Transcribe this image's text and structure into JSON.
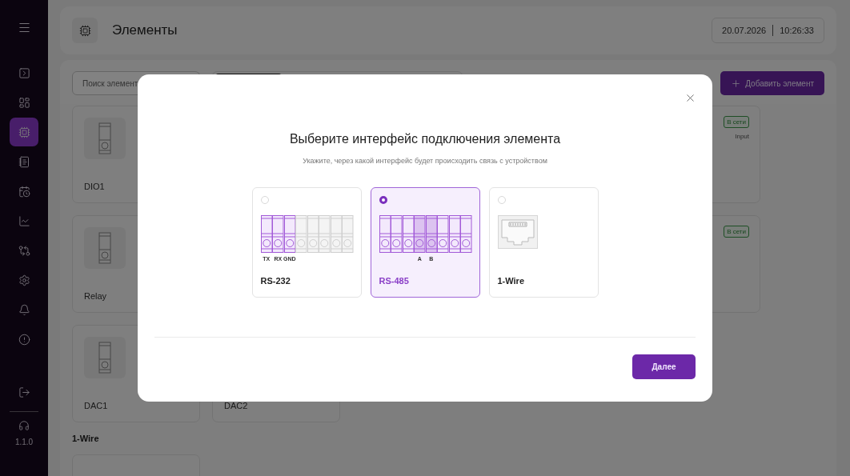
{
  "sidebar": {
    "items": [
      {
        "selected": false
      },
      {
        "selected": false
      },
      {
        "selected": true
      },
      {
        "selected": false
      },
      {
        "selected": false
      },
      {
        "selected": false
      },
      {
        "selected": false
      },
      {
        "selected": false
      },
      {
        "selected": false
      },
      {
        "selected": false
      }
    ],
    "version": "1.1.0"
  },
  "header": {
    "title": "Элементы",
    "date": "20.07.2026",
    "time": "10:26:33"
  },
  "toolbar": {
    "search": {
      "placeholder": "Поиск элемент"
    },
    "add_button": "Добавить элемент"
  },
  "cards": [
    {
      "kind": "device",
      "name": "DIO1"
    },
    {
      "kind": "status",
      "status": "В сети",
      "type": "Input"
    },
    {
      "kind": "device",
      "name": "Relay"
    },
    {
      "kind": "status",
      "status": "В сети"
    },
    {
      "kind": "device",
      "name": "DAC1"
    },
    {
      "kind": "name_only",
      "name": "DAC2"
    }
  ],
  "section": {
    "title": "1-Wire"
  },
  "modal": {
    "title": "Выберите интерфейс подключения элемента",
    "subtitle": "Укажите, через какой интерфейс будет происходить связь с устройством",
    "options": [
      {
        "label": "RS-232",
        "selected": false,
        "kind": "terminal",
        "terminals": [
          {
            "active": true,
            "highlighted": false,
            "label": "TX"
          },
          {
            "active": true,
            "highlighted": false,
            "label": "RX"
          },
          {
            "active": true,
            "highlighted": false,
            "label": "GND"
          },
          {
            "active": false,
            "highlighted": false
          },
          {
            "active": false,
            "highlighted": false
          },
          {
            "active": false,
            "highlighted": false
          },
          {
            "active": false,
            "highlighted": false
          },
          {
            "active": false,
            "highlighted": false
          }
        ]
      },
      {
        "label": "RS-485",
        "selected": true,
        "kind": "terminal",
        "terminals": [
          {
            "active": true,
            "highlighted": false
          },
          {
            "active": true,
            "highlighted": false
          },
          {
            "active": true,
            "highlighted": false
          },
          {
            "active": true,
            "highlighted": true,
            "label": "A"
          },
          {
            "active": true,
            "highlighted": true,
            "label": "B"
          },
          {
            "active": true,
            "highlighted": false
          },
          {
            "active": true,
            "highlighted": false
          },
          {
            "active": true,
            "highlighted": false
          }
        ]
      },
      {
        "label": "1-Wire",
        "selected": false,
        "kind": "port"
      }
    ],
    "next_button": "Далее"
  }
}
